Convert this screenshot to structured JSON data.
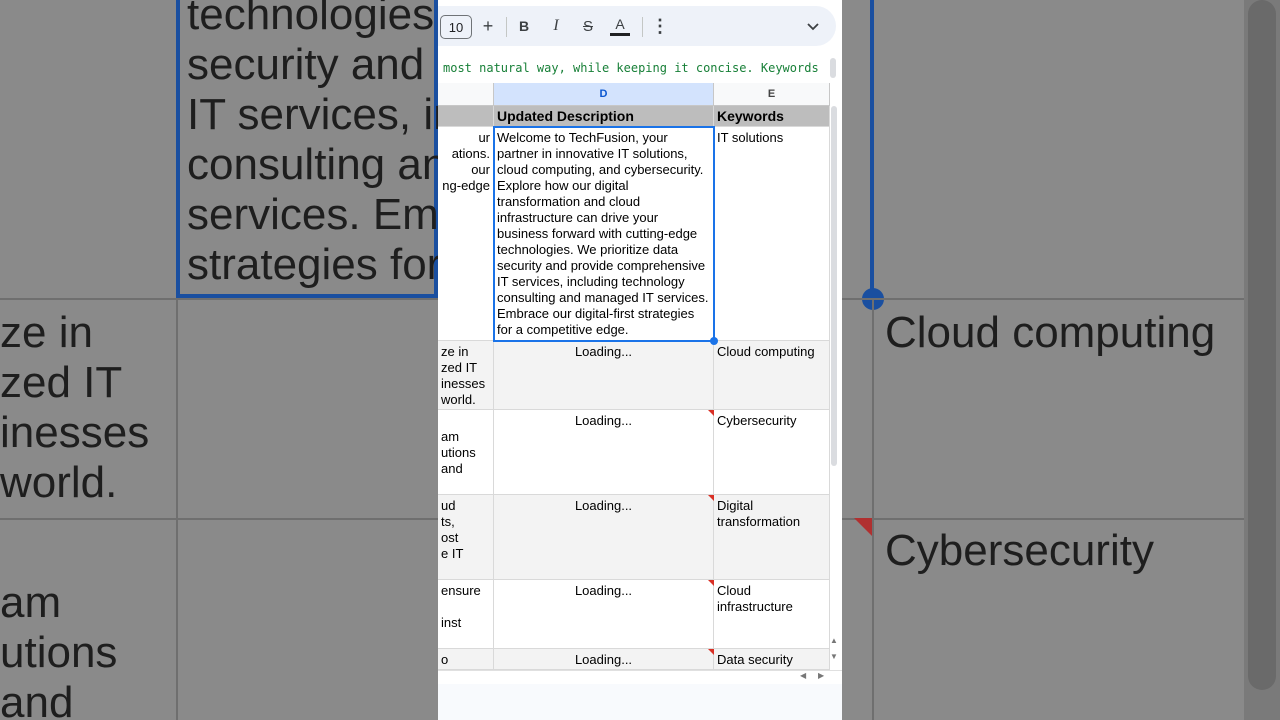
{
  "background": {
    "left_text": [
      "technologies.",
      "security and p",
      "IT services, in",
      "consulting an",
      "services. Emb",
      "strategies for"
    ],
    "left_lower_text": [
      "ze in",
      "zed IT",
      "inesses",
      "world."
    ],
    "left_bottom_text": [
      "am",
      "utions",
      "and"
    ],
    "right_text_1": "Cloud computing",
    "right_text_2": "Cybersecurity"
  },
  "toolbar": {
    "font_size": "10",
    "plus_label": "+",
    "bold_label": "B",
    "italic_label": "I",
    "strike_label": "S",
    "text_color_label": "A",
    "more_label": "⋮",
    "expand_label": "⌄"
  },
  "formula_bar": {
    "text": " most natural way, while keeping it concise. Keywords"
  },
  "columns": {
    "d_header": "D",
    "e_header": "E"
  },
  "rows": [
    {
      "c": "",
      "d": "Updated Description",
      "e": "Keywords"
    },
    {
      "c": "ur\nations.\nour\nng-edge",
      "d": "Welcome to TechFusion, your partner in innovative IT solutions, cloud computing, and cybersecurity. Explore how our digital transformation and cloud infrastructure can drive your business forward with cutting-edge technologies. We prioritize data security and provide comprehensive IT services, including technology consulting and managed IT services. Embrace our digital-first strategies for a competitive edge.",
      "e": "IT solutions"
    },
    {
      "c": "ze in\nzed IT\ninesses\nworld.",
      "d": "Loading...",
      "e": "Cloud computing"
    },
    {
      "c": "am\nutions\nand",
      "d": "Loading...",
      "e": "Cybersecurity"
    },
    {
      "c": "ud\nts,\nost\ne IT",
      "d": "Loading...",
      "e": "Digital transformation"
    },
    {
      "c": "ensure\n\ninst",
      "d": "Loading...",
      "e": "Cloud infrastructure"
    },
    {
      "c": "o",
      "d": "Loading...",
      "e": "Data security"
    }
  ],
  "colors": {
    "selection": "#1a73e8",
    "header_fill": "#bdbdbd",
    "formula_text": "#188038",
    "note_marker": "#d93025"
  }
}
